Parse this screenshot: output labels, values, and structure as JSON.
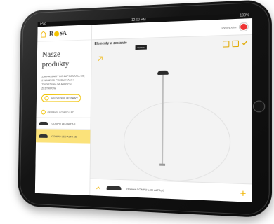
{
  "status": {
    "carrier": "iPad",
    "time": "12:00 PM",
    "battery": "100%"
  },
  "app": {
    "logo": {
      "pre": "R",
      "post": "SA"
    },
    "title": "Nasze produkty",
    "description": "ZAPRASZAMY DO ZAPOZNANIA SIĘ Z NASZYMI PRODUKTAMI I TWORZENIA WŁASNYCH ZESTAWÓW",
    "all_sets_label": "WSZYSTKIE ZESTAWY",
    "section_label": "OPRAWY COMPO LED",
    "items": [
      {
        "label": "COMPO LED ALFA p"
      },
      {
        "label": "COMPO LED ALFA p5"
      }
    ]
  },
  "workspace": {
    "distributor_label": "Dystrybutor",
    "elements_label": "Elementy w zestawie",
    "tooltip_label": "Oprawa",
    "selected_product": "Oprawa COMPO LED ALFA p5"
  },
  "colors": {
    "accent": "#f0c200",
    "selected": "#fbe27a"
  },
  "icons": [
    "home-icon",
    "save-icon",
    "delete-icon",
    "confirm-icon",
    "plus-icon",
    "chevron-up-icon"
  ]
}
